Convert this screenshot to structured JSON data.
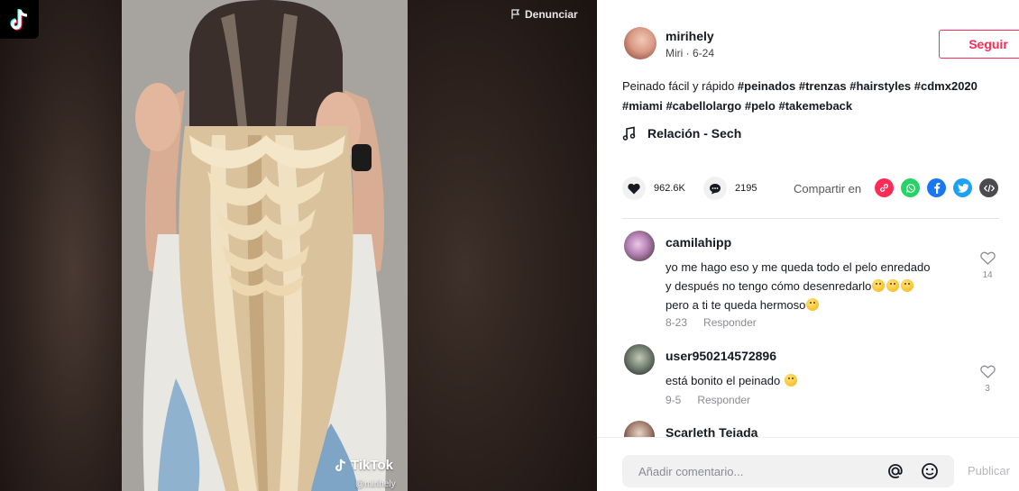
{
  "video": {
    "report_label": "Denunciar",
    "watermark_brand": "TikTok",
    "watermark_user": "@mirihely"
  },
  "author": {
    "username": "mirihely",
    "meta": "Miri · 6-24",
    "follow_label": "Seguir"
  },
  "description": {
    "text": "Peinado fácil y rápido ",
    "hashtags": [
      "#peinados",
      "#trenzas",
      "#hairstyles",
      "#cdmx2020",
      "#miami",
      "#cabellolargo",
      "#pelo",
      "#takemeback"
    ]
  },
  "music": {
    "title": "Relación - Sech"
  },
  "stats": {
    "likes": "962.6K",
    "comments": "2195",
    "share_label": "Compartir en"
  },
  "share_targets": [
    {
      "name": "link",
      "icon": "link-icon",
      "color": "#fe2c55"
    },
    {
      "name": "whatsapp",
      "icon": "whatsapp-icon",
      "color": "#25d366"
    },
    {
      "name": "facebook",
      "icon": "facebook-icon",
      "color": "#1877f2"
    },
    {
      "name": "twitter",
      "icon": "twitter-icon",
      "color": "#1da1f2"
    },
    {
      "name": "embed",
      "icon": "embed-icon",
      "color": "#4a4a4f"
    }
  ],
  "comments": [
    {
      "user": "camilahipp",
      "lines": [
        "yo me hago eso y me queda todo el pelo enredado",
        "y después no tengo cómo desenredarlo",
        "pero a ti te queda hermoso"
      ],
      "date": "8-23",
      "reply_label": "Responder",
      "likes": "14"
    },
    {
      "user": "user950214572896",
      "lines": [
        "está bonito el peinado"
      ],
      "date": "9-5",
      "reply_label": "Responder",
      "likes": "3"
    },
    {
      "user": "Scarleth Tejada",
      "lines": [],
      "date": "",
      "reply_label": "",
      "likes": ""
    }
  ],
  "composer": {
    "placeholder": "Añadir comentario...",
    "post_label": "Publicar"
  },
  "colors": {
    "accent": "#fe2c55",
    "text": "#161823",
    "muted": "#8a8b91"
  }
}
